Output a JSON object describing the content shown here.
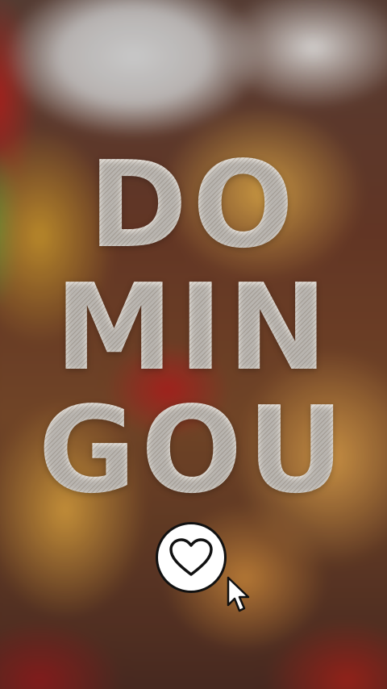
{
  "title": {
    "line1": "DO",
    "line2": "MIN",
    "line3": "GOU"
  },
  "icons": {
    "heart": "heart-icon",
    "cursor": "pointer-cursor-icon"
  },
  "colors": {
    "title_text": "#f4efe9",
    "button_bg": "#ffffff",
    "button_border": "#111111"
  }
}
